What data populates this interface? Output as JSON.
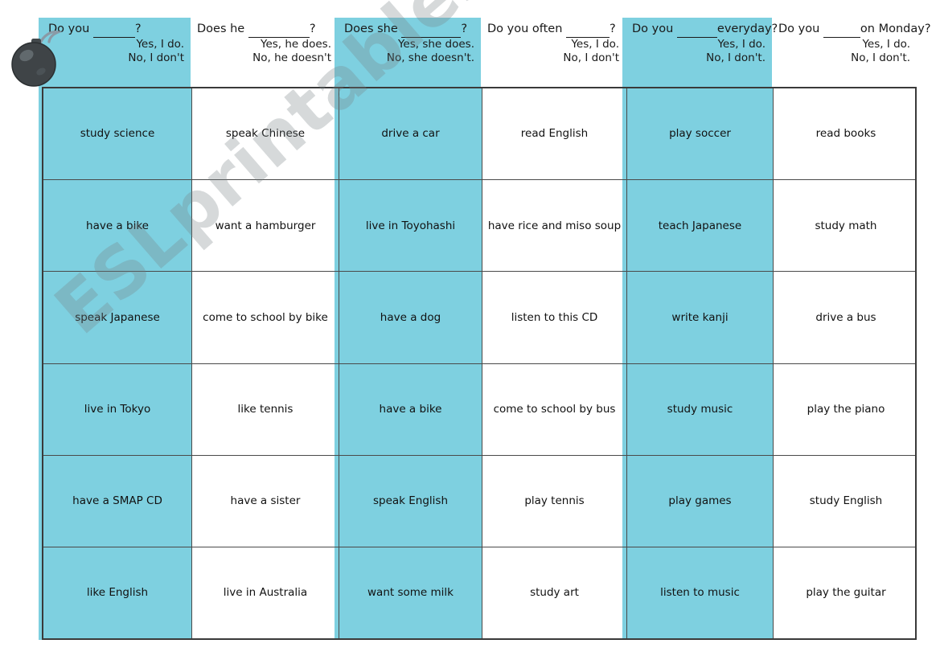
{
  "worksheet": {
    "watermark": "ESLprintables.com",
    "bomb_icon": "bomb-icon",
    "colors": {
      "shaded_column": "#7ed0e0",
      "border": "#4a4a4a",
      "outer_border": "#3a3a3a",
      "text": "#111111",
      "watermark": "#78808699",
      "bomb_body": "#3f4447"
    }
  },
  "columns": [
    {
      "index": 0,
      "shaded": true,
      "question_prefix": "Do you",
      "question_suffix": "?",
      "blank_width": 52,
      "answer_yes": "Yes, I do.",
      "answer_no": "No, I don't"
    },
    {
      "index": 1,
      "shaded": false,
      "question_prefix": "Does he",
      "question_suffix": "?",
      "blank_width": 76,
      "answer_yes": "Yes, he does.",
      "answer_no": "No, he doesn't"
    },
    {
      "index": 2,
      "shaded": true,
      "question_prefix": "Does she",
      "question_suffix": "?",
      "blank_width": 74,
      "answer_yes": "Yes, she does.",
      "answer_no": "No, she doesn't."
    },
    {
      "index": 3,
      "shaded": false,
      "question_prefix": "Do you often",
      "question_suffix": "?",
      "blank_width": 54,
      "answer_yes": "Yes, I do.",
      "answer_no": "No, I don't"
    },
    {
      "index": 4,
      "shaded": true,
      "question_prefix": "Do you",
      "question_suffix": "everyday?",
      "blank_width": 50,
      "answer_yes": "Yes, I do.",
      "answer_no": "No, I don't."
    },
    {
      "index": 5,
      "shaded": false,
      "question_prefix": "Do you",
      "question_suffix": "on Monday?",
      "blank_width": 46,
      "answer_yes": "Yes, I do.",
      "answer_no": "No, I don't."
    }
  ],
  "rows": [
    [
      "study science",
      "speak Chinese",
      "drive a car",
      "read English",
      "play soccer",
      "read books"
    ],
    [
      "have a bike",
      "want a hamburger",
      "live in Toyohashi",
      "have rice and miso soup",
      "teach Japanese",
      "study math"
    ],
    [
      "speak Japanese",
      "come to school by bike",
      "have a dog",
      "listen to this CD",
      "write kanji",
      "drive a bus"
    ],
    [
      "live in Tokyo",
      "like tennis",
      "have a bike",
      "come to school by bus",
      "study music",
      "play the piano"
    ],
    [
      "have a SMAP CD",
      "have a sister",
      "speak English",
      "play tennis",
      "play games",
      "study English"
    ],
    [
      "like English",
      "live in Australia",
      "want some milk",
      "study art",
      "listen to music",
      "play the guitar"
    ]
  ]
}
